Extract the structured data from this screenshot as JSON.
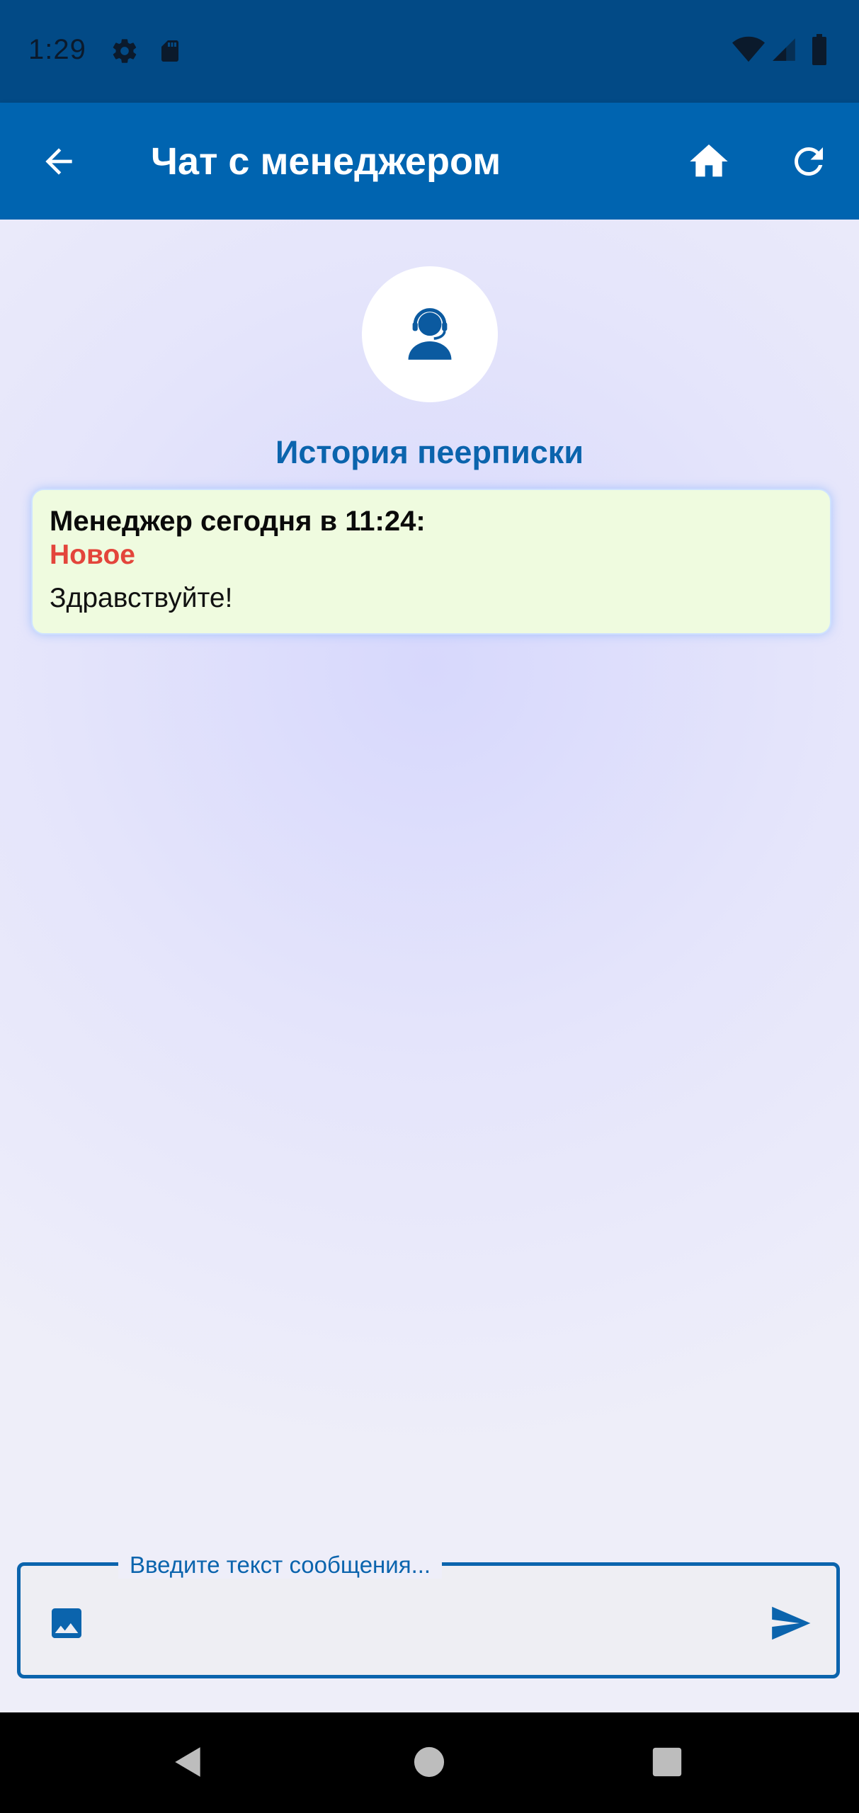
{
  "status_bar": {
    "time": "1:29",
    "icons": [
      "settings-icon",
      "sd-card-icon",
      "wifi-icon",
      "signal-icon",
      "battery-icon"
    ]
  },
  "app_bar": {
    "title": "Чат с менеджером",
    "back_icon": "back-arrow-icon",
    "home_icon": "home-icon",
    "refresh_icon": "refresh-icon"
  },
  "chat": {
    "avatar_icon": "support-agent-icon",
    "history_title": "История пеерписки",
    "messages": [
      {
        "author": "Менеджер сегодня в 11:24:",
        "badge": "Новое",
        "text": "Здравствуйте!"
      }
    ]
  },
  "composer": {
    "placeholder": "Введите текст сообщения...",
    "value": "",
    "attach_icon": "image-icon",
    "send_icon": "send-icon"
  },
  "colors": {
    "status_bar": "#024a86",
    "app_bar": "#0064b0",
    "accent": "#0b64ad",
    "badge_new": "#e3453b",
    "message_bg": "#effbdf"
  }
}
